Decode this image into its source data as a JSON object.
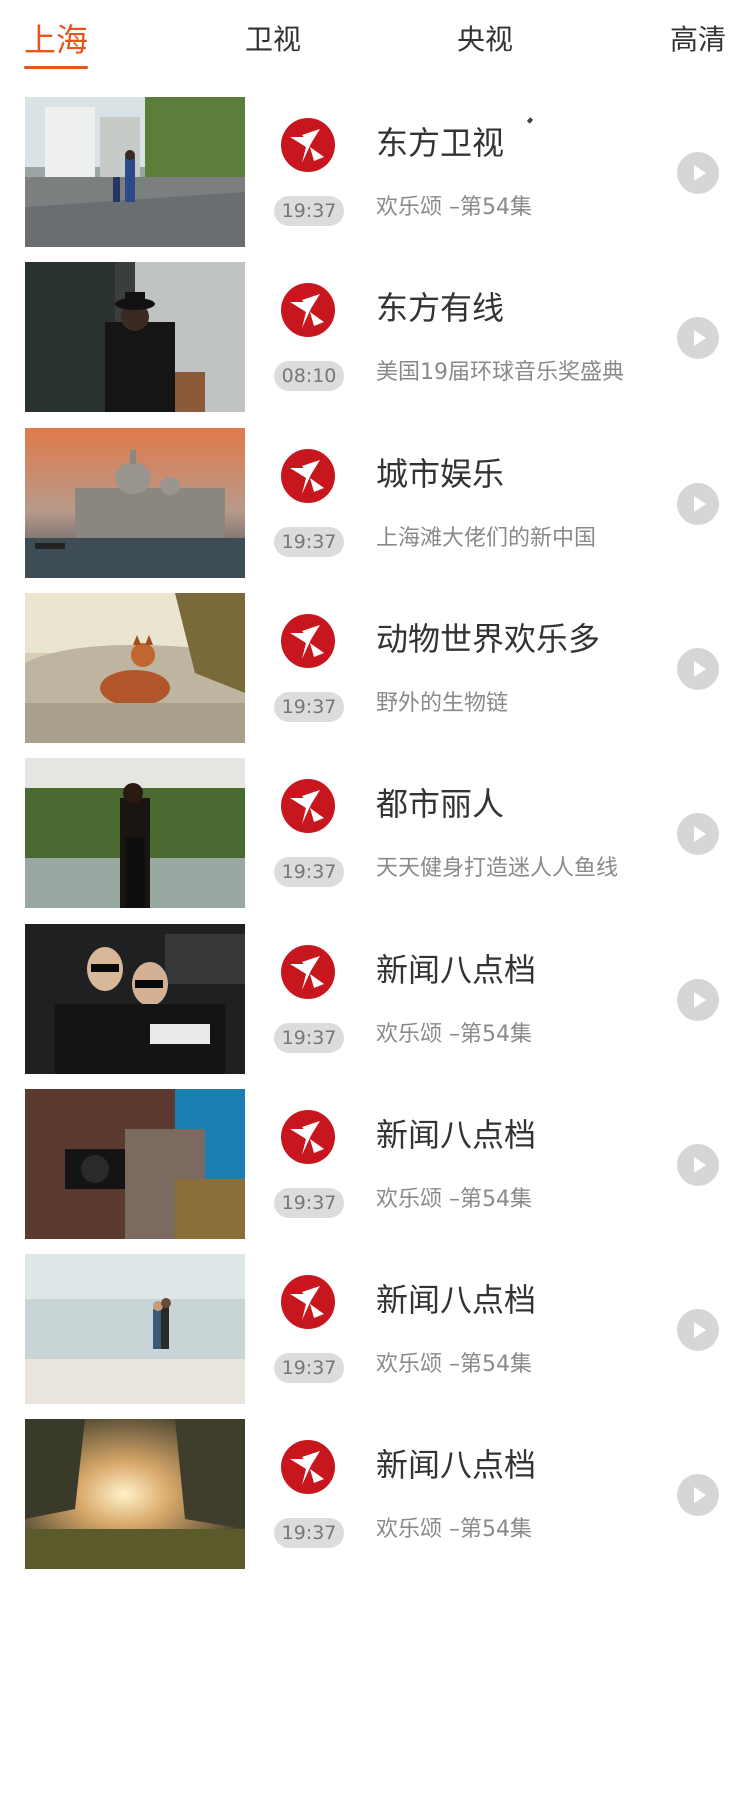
{
  "tabs": [
    {
      "label": "上海",
      "active": true
    },
    {
      "label": "卫视",
      "active": false
    },
    {
      "label": "央视",
      "active": false
    },
    {
      "label": "高清",
      "active": false
    }
  ],
  "accent_color": "#e8541e",
  "logo_color": "#c8161e",
  "items": [
    {
      "title": "东方卫视",
      "subtitle": "欢乐颂 –第54集",
      "time": "19:37",
      "thumb": "street-scene"
    },
    {
      "title": "东方有线",
      "subtitle": "美国19届环球音乐奖盛典",
      "time": "08:10",
      "thumb": "man-in-hat"
    },
    {
      "title": "城市娱乐",
      "subtitle": "上海滩大佬们的新中国",
      "time": "19:37",
      "thumb": "venice-sunset"
    },
    {
      "title": "动物世界欢乐多",
      "subtitle": "野外的生物链",
      "time": "19:37",
      "thumb": "fox-in-grass"
    },
    {
      "title": "都市丽人",
      "subtitle": "天天健身打造迷人人鱼线",
      "time": "19:37",
      "thumb": "woman-by-river"
    },
    {
      "title": "新闻八点档",
      "subtitle": "欢乐颂 –第54集",
      "time": "19:37",
      "thumb": "couple-sunglasses"
    },
    {
      "title": "新闻八点档",
      "subtitle": "欢乐颂 –第54集",
      "time": "19:37",
      "thumb": "camera-woman"
    },
    {
      "title": "新闻八点档",
      "subtitle": "欢乐颂 –第54集",
      "time": "19:37",
      "thumb": "beach-couple"
    },
    {
      "title": "新闻八点档",
      "subtitle": "欢乐颂 –第54集",
      "time": "19:37",
      "thumb": "sunset-forest"
    }
  ]
}
